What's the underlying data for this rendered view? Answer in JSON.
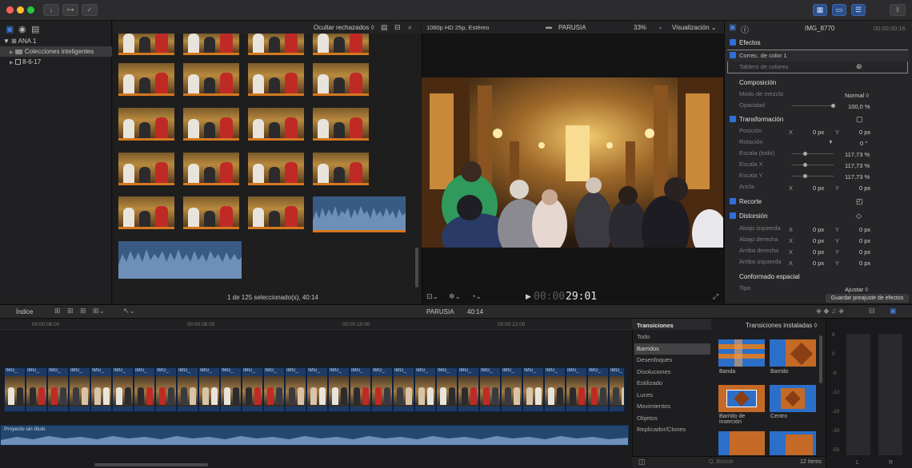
{
  "toolbar": {
    "key_icon": "key-icon",
    "check_icon": "check-circle-icon",
    "download_icon": "download-arrow-icon",
    "right_icons": [
      "grid-blue-icon",
      "list-icon",
      "sliders-icon",
      "share-icon"
    ]
  },
  "library": {
    "items": [
      {
        "label": "ANA 1",
        "prefix": "▼"
      },
      {
        "label": "Colecciones inteligentes",
        "prefix": "▶"
      },
      {
        "label": "8-6-17",
        "prefix": "▶"
      }
    ]
  },
  "browser": {
    "filter_label": "Ocultar rechazados ◊",
    "status_text": "1 de 125 seleccionado(s), 40:14"
  },
  "viewer": {
    "format_label": "1080p HD 25p, Estéreo",
    "project_name": "PARUSIA",
    "zoom": "33%",
    "view_menu": "Visualización ⌄",
    "timecode_dim": "00:00",
    "timecode": "29:01"
  },
  "inspector": {
    "clip_name": "IMG_8770",
    "clip_time": "00:00:00:16",
    "effects_label": "Efectos",
    "color_correction": "Correc. de color 1",
    "color_board": "Tablero de colores",
    "composition": "Composición",
    "blend_mode": "Modo de mezcla",
    "blend_value": "Normal ◊",
    "opacity": "Opacidad",
    "opacity_value": "100,0 %",
    "transform": "Transformación",
    "position": "Posición",
    "position_x": "0 px",
    "position_y": "0 px",
    "rotation": "Rotación",
    "rotation_value": "0 °",
    "scale_all": "Escala (todo)",
    "scale_all_value": "117,73 %",
    "scale_x": "Escala X",
    "scale_x_value": "117,73 %",
    "scale_y": "Escala Y",
    "scale_y_value": "117,73 %",
    "anchor": "Ancla",
    "anchor_x": "0 px",
    "anchor_y": "0 px",
    "crop": "Recorte",
    "distortion": "Distorsión",
    "bottom_left": "Abajo izquierda",
    "bottom_right": "Abajo derecha",
    "top_right": "Arriba derecha",
    "top_left": "Arriba izquierda",
    "corner_value": "0 px",
    "spatial": "Conformado espacial",
    "type": "Tipo",
    "type_value": "Ajustar ◊",
    "save_preset": "Guardar preajuste de efectos",
    "x_label": "X",
    "y_label": "Y"
  },
  "timeline": {
    "index_button": "Índice",
    "project_label": "PARUSIA",
    "duration": "40:14",
    "ruler": [
      "00:00:06:00",
      "00:00:08:00",
      "00:00:10:00",
      "00:00:12:00"
    ],
    "clip_label": "IMG_",
    "audio_label": "Proyecto sin título"
  },
  "transitions": {
    "header": "Transiciones",
    "installed": "Transiciones instaladas ◊",
    "categories": [
      "Todo",
      "Barridos",
      "Desenfoques",
      "Disoluciones",
      "Estilizado",
      "Luces",
      "Movimientos",
      "Objetos",
      "Replicador/Clones"
    ],
    "selected_index": 1,
    "items": [
      "Banda",
      "Barrido",
      "Barrido de inserción",
      "Centro"
    ],
    "search_placeholder": "Q, Buscar",
    "count": "12 ítems"
  },
  "meters": {
    "scale": [
      "6",
      "0",
      "-6",
      "-12",
      "-20",
      "-30",
      "-50"
    ],
    "channels": [
      "L",
      "R"
    ]
  }
}
